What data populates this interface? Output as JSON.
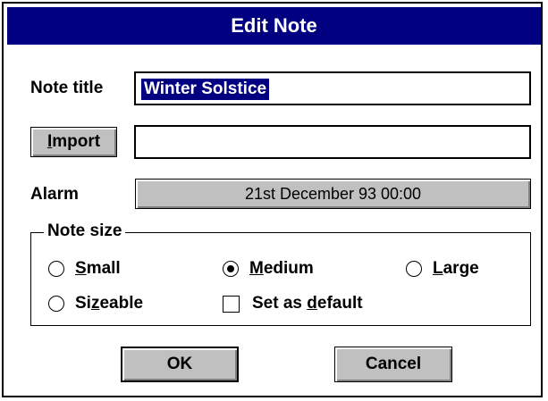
{
  "window": {
    "title": "Edit Note"
  },
  "fields": {
    "title_label": "Note title",
    "title_value": "Winter Solstice",
    "import_button": {
      "pre": "",
      "accel": "I",
      "post": "mport"
    },
    "import_value": "",
    "alarm_label": "Alarm",
    "alarm_value": "21st December 93 00:00"
  },
  "note_size": {
    "legend": "Note size",
    "options": [
      {
        "pre": "",
        "accel": "S",
        "post": "mall",
        "selected": false
      },
      {
        "pre": "",
        "accel": "M",
        "post": "edium",
        "selected": true
      },
      {
        "pre": "",
        "accel": "L",
        "post": "arge",
        "selected": false
      },
      {
        "pre": "Si",
        "accel": "z",
        "post": "eable",
        "selected": false
      }
    ],
    "default_checkbox": {
      "pre": "Set as ",
      "accel": "d",
      "post": "efault",
      "checked": false
    }
  },
  "buttons": {
    "ok": "OK",
    "cancel": "Cancel"
  }
}
